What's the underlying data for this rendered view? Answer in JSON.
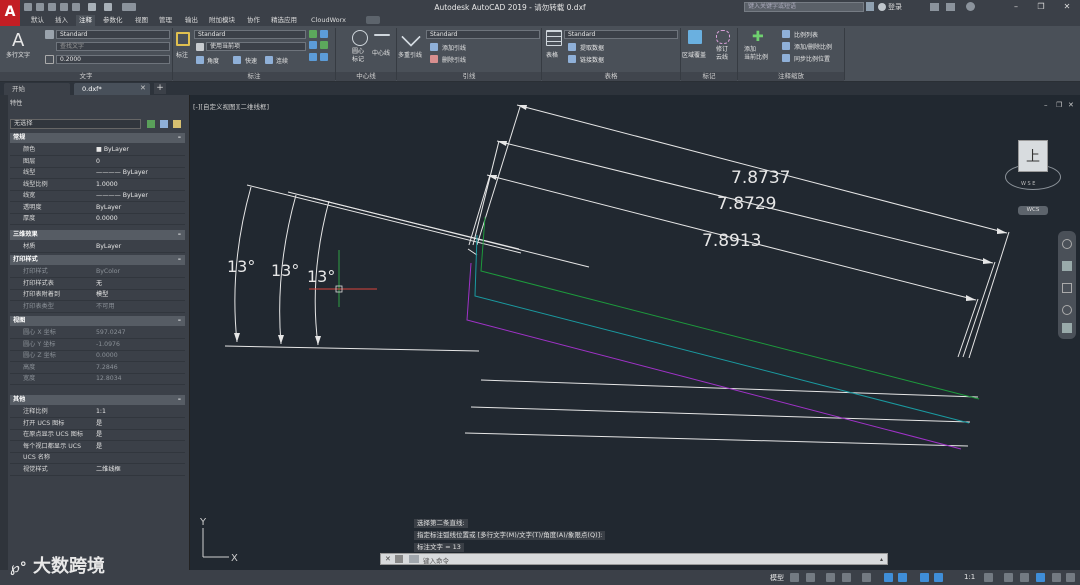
{
  "title": "Autodesk AutoCAD 2019  -  请勿转载    0.dxf",
  "search_placeholder": "键入关键字或短语",
  "user": "登录",
  "ribbon_tabs": [
    "默认",
    "插入",
    "注释",
    "参数化",
    "视图",
    "管理",
    "输出",
    "附加模块",
    "协作",
    "精选应用",
    "CloudWorx"
  ],
  "ribbon": {
    "text_panel": {
      "title": "文字",
      "big_button": "多行文字",
      "style": "Standard",
      "find_placeholder": "查找文字",
      "height": "0.2000"
    },
    "dim_panel": {
      "title": "标注",
      "button": "标注",
      "style": "Standard",
      "layer": "使用当前项",
      "angle": "角度",
      "quick": "快速",
      "continue": "连续"
    },
    "center_panel": {
      "title": "中心线",
      "center_mark": "圆心\n标记",
      "centerline": "中心线"
    },
    "leader_panel": {
      "title": "引线",
      "button": "多重引线",
      "style": "Standard",
      "add": "添加引线",
      "remove": "删除引线"
    },
    "table_panel": {
      "title": "表格",
      "button": "表格",
      "style": "Standard",
      "extract": "提取数据",
      "link": "链接数据"
    },
    "markup_panel": {
      "title": "标记",
      "wipeout": "区域覆盖",
      "revcloud": "修订\n云线"
    },
    "scale_panel": {
      "title": "注释缩放",
      "add_scale": "添加\n当前比例",
      "list": "比例列表",
      "add_delete": "添加/删除比例",
      "sync": "同步比例位置"
    }
  },
  "file_tabs": [
    "开始",
    "0.dxf*"
  ],
  "properties": {
    "header": "特性",
    "selection": "无选择",
    "sections": [
      {
        "name": "常规",
        "rows": [
          [
            "颜色",
            "■ ByLayer"
          ],
          [
            "图层",
            "0"
          ],
          [
            "线型",
            "———— ByLayer"
          ],
          [
            "线型比例",
            "1.0000"
          ],
          [
            "线宽",
            "———— ByLayer"
          ],
          [
            "透明度",
            "ByLayer"
          ],
          [
            "厚度",
            "0.0000"
          ]
        ]
      },
      {
        "name": "三维效果",
        "rows": [
          [
            "材质",
            "ByLayer"
          ]
        ]
      },
      {
        "name": "打印样式",
        "rows": [
          [
            "打印样式",
            "ByColor"
          ],
          [
            "打印样式表",
            "无"
          ],
          [
            "打印表附着到",
            "模型"
          ],
          [
            "打印表类型",
            "不可用"
          ]
        ]
      },
      {
        "name": "视图",
        "rows": [
          [
            "圆心 X 坐标",
            "597.0247"
          ],
          [
            "圆心 Y 坐标",
            "-1.0976"
          ],
          [
            "圆心 Z 坐标",
            "0.0000"
          ],
          [
            "高度",
            "7.2846"
          ],
          [
            "宽度",
            "12.8034"
          ]
        ]
      },
      {
        "name": "其他",
        "rows": [
          [
            "注释比例",
            "1:1"
          ],
          [
            "打开 UCS 图标",
            "是"
          ],
          [
            "在原点显示 UCS 图标",
            "是"
          ],
          [
            "每个视口都显示 UCS",
            "是"
          ],
          [
            "UCS 名称",
            ""
          ],
          [
            "视觉样式",
            "二维线框"
          ]
        ]
      }
    ]
  },
  "viewport": {
    "label": "[-][自定义视图][二维线框]",
    "dims": [
      "7.8737",
      "7.8729",
      "7.8913"
    ],
    "angles": [
      "13°",
      "13°",
      "13°"
    ],
    "cube_face": "上",
    "cube_compass": "W  S  E",
    "wcs": "WCS",
    "ucs_x": "X",
    "ucs_y": "Y"
  },
  "command": {
    "history": [
      "选择第二条直线:",
      "指定标注弧线位置或 [多行文字(M)/文字(T)/角度(A)/象限点(Q)]:",
      "标注文字 = 13"
    ],
    "placeholder": "键入命令"
  },
  "status": {
    "model": "模型",
    "scale": "1:1"
  },
  "watermark": "大数跨境",
  "colors": {
    "green": "#1d9a3c",
    "cyan": "#1a9aa0",
    "magenta": "#a032c8",
    "white": "#e6e6e6",
    "accent_red": "#c31e24"
  }
}
